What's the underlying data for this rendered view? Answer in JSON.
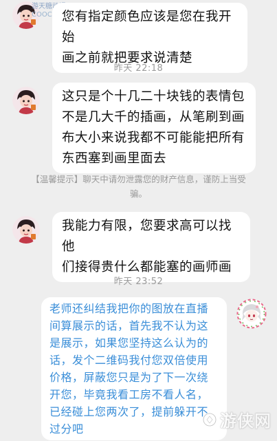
{
  "watermark_top": {
    "name": "游天糖动漫",
    "url": "COOCC.COM"
  },
  "watermark_bottom": "游侠网",
  "messages": [
    {
      "side": "in",
      "lines": [
        "您有指定颜色应该是您在我开始",
        "画之前就把要求说清楚"
      ]
    },
    {
      "time": "昨天 22:18"
    },
    {
      "side": "in",
      "lines": [
        "这只是个十几二十块钱的表情包",
        "不是几大千的插画，从笔刷到画",
        "布大小来说我都不可能能把所有",
        "东西塞到画里面去"
      ]
    },
    {
      "notice_lines": [
        "【温馨提示】聊天中请勿泄露您的财产信息，谨防上当受",
        "骗。"
      ]
    },
    {
      "side": "in",
      "lines": [
        "我能力有限，您要求高可以找他",
        "们接得贵什么都能塞的画师画"
      ]
    },
    {
      "time": "昨天 23:52"
    },
    {
      "side": "out",
      "lines": [
        "老师还纠结我把你的图放在直播",
        "间算展示的话，首先我不认为这",
        "是展示，如果您坚持这么认为的",
        "话，发个二维码我付您双倍使用",
        "价格，屏蔽您只是为了下一次绕",
        "开您，毕竟我看工房不看人名，",
        "已经碰上您两次了，提前躲开不",
        "过分吧"
      ]
    }
  ],
  "colors": {
    "background": "#eeeeee",
    "bubble": "#ffffff",
    "incoming_text": "#111111",
    "outgoing_text": "#3a8ed8",
    "system_text": "#9a9a9a"
  }
}
